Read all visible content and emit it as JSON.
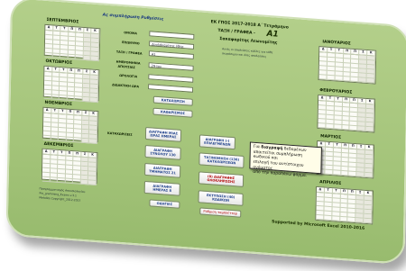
{
  "header": {
    "title_left": "Ας συμπλήρωση Ρυθμίσεις",
    "school": "ΕΚ ΓΠΟΣ 2017-2018 Α΄ Τετράμηνο",
    "class_label": "ΤΑΞΗ / ΓΡΑΦΕΑ -",
    "class_value": "Α1",
    "teacher": "Σακαφαρίτης Λεωνυμίτης",
    "subtitle1": "Αυτές οι απολεύσεις κάλλες για κάθε",
    "subtitle2": "ακυρόσιμου και όλες απολεύσεις"
  },
  "months": {
    "sep": "ΣΕΠΤΕΜΒΡΙΟΣ",
    "oct": "ΟΚΤΩΒΡΙΟΣ",
    "nov": "ΝΟΕΜΒΡΙΟΣ",
    "dec": "ΔΕΚΕΜΒΡΙΟΣ",
    "jan": "ΙΑΝΟΥΑΡΙΟΣ",
    "feb": "ΦΕΒΡΟΥΑΡΙΟΣ",
    "mar": "ΜΑΡΤΙΟΣ",
    "apr": "ΑΠΡΙΛΙΟΣ"
  },
  "weekdays": [
    "Δ",
    "Τ",
    "Τ",
    "Π",
    "Π",
    "Σ",
    "Κ"
  ],
  "form": {
    "name_label": "ΟΝΟΜΑ",
    "surname_label": "ΕΠΩΝΥΜΟ",
    "surname_value": "Δουλάκαρίτης (Θερ",
    "class_label": "ΤΑΞΗ / ΓΡΑΦΕΑ",
    "class_value": "Α1",
    "date_label1": "ΗΜΕΡΟΜΗΝΙΑ",
    "date_label2": "ΑΠΟΥΣΙΑΣ",
    "date_value": "29-Ιαν",
    "hour_label": "ΩΡΟΛΟΓΙΑ",
    "lesson_label": "ΔΙΔΑΚΤΙΚΗ ΩΡΑ"
  },
  "buttons": {
    "register": "ΚΑΤΑΧΩΡΙΣΗ",
    "clear": "ΚΑΘΑΡΙΣΜΟΣ",
    "group_label": "ΚΑΤΑΧΩΡΙΣΕΙΣ",
    "del_day": "ΔΙΑΓΡΑΦΗ ΜΙΑΣ ΩΡΑΣ ΗΜΕΡΑΣ",
    "del_selected": "ΔΙΑΓΡΑΦΗ (-) ΕΠΙΛΕΓΜΕΝΩΝ",
    "del_group": "ΔΙΑΓΡΑΦΗ ΣΥΝΟΛΟΥ 130",
    "sort": "ΤΑΞΙΝΟΜΗΣΗ (130) ΚΑΤΑΧΩΡΙΣΕΩΝ",
    "del_section": "ΔΙΑΓΡΑΦΗ ΤΜΗΜΑΤΟΣ 21",
    "del_all": "(0) ΔΙΑΓΡΑΦΗΣ ΟΛΟΚΛΗΡΩΣΗΣ",
    "del_date": "ΔΙΑΓΡΑΦΗ ΗΜΕΡΑΣ 8",
    "print": "ΕΚΤΥΠΩΣΗ (40) ΚΩΔΙΚΩΝ",
    "help": "ΟΔΗΓΙΕΣ",
    "settings": "Ρύθμιση ταμπλέτταρ"
  },
  "note": {
    "line1_pre": "Για ",
    "line1_b": "διαγραφή",
    "line1_post": " δεδομένων",
    "line2": "απαιτείται συμπλήρωση κωδικού και",
    "line3": "επιλογή του αντίστοιχου ονόματος",
    "line4": "από την παραπάνω φόρμα."
  },
  "footer": {
    "prog1": "Προγραμματισμός Απουσιολογίου",
    "prog2": "Pro_gramming_Exams v.3.1",
    "prog3": "Metallos Copyright_2012-2017",
    "supported": "Supported by Microsoft Excel 2010-2016"
  }
}
